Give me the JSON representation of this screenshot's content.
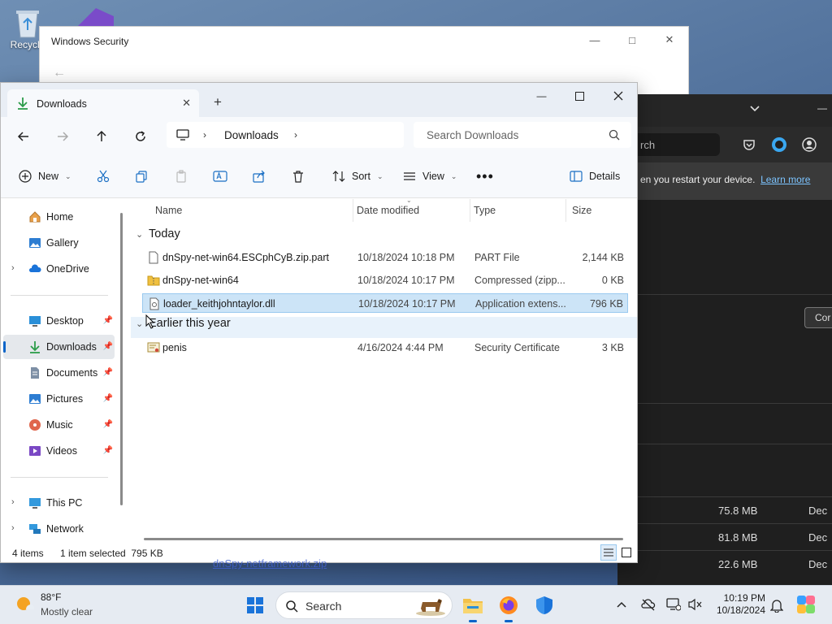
{
  "desktop": {
    "recycle_label": "Recycle"
  },
  "winsec": {
    "title": "Windows Security"
  },
  "browser_bg": {
    "search_placeholder": "rch",
    "notice_text": "en you restart your device.",
    "notice_link": "Learn more",
    "button_label": "Cor",
    "downloads": [
      {
        "size": "75.8 MB",
        "date": "Dec "
      },
      {
        "size": "81.8 MB",
        "date": "Dec "
      },
      {
        "size": "22.6 MB",
        "date": "Dec "
      }
    ],
    "partial_link": "dnSpy-netframework.zip"
  },
  "explorer": {
    "tab_title": "Downloads",
    "breadcrumb": "Downloads",
    "search_placeholder": "Search Downloads",
    "toolbar": {
      "new_label": "New",
      "sort_label": "Sort",
      "view_label": "View",
      "details_label": "Details"
    },
    "nav": {
      "items": [
        {
          "label": "Home",
          "icon": "home-icon"
        },
        {
          "label": "Gallery",
          "icon": "gallery-icon"
        },
        {
          "label": "OneDrive",
          "icon": "cloud-icon"
        },
        {
          "label": "Desktop",
          "icon": "desktop-icon"
        },
        {
          "label": "Downloads",
          "icon": "download-icon"
        },
        {
          "label": "Documents",
          "icon": "documents-icon"
        },
        {
          "label": "Pictures",
          "icon": "pictures-icon"
        },
        {
          "label": "Music",
          "icon": "music-icon"
        },
        {
          "label": "Videos",
          "icon": "videos-icon"
        },
        {
          "label": "This PC",
          "icon": "pc-icon"
        },
        {
          "label": "Network",
          "icon": "network-icon"
        }
      ]
    },
    "columns": {
      "name": "Name",
      "date": "Date modified",
      "type": "Type",
      "size": "Size"
    },
    "groups": [
      {
        "label": "Today",
        "files": [
          {
            "name": "dnSpy-net-win64.ESCphCyB.zip.part",
            "date": "10/18/2024 10:18 PM",
            "type": "PART File",
            "size": "2,144 KB",
            "icon": "file-icon"
          },
          {
            "name": "dnSpy-net-win64",
            "date": "10/18/2024 10:17 PM",
            "type": "Compressed (zipp...",
            "size": "0 KB",
            "icon": "zip-folder-icon"
          },
          {
            "name": "loader_keithjohntaylor.dll",
            "date": "10/18/2024 10:17 PM",
            "type": "Application extens...",
            "size": "796 KB",
            "icon": "dll-file-icon"
          }
        ]
      },
      {
        "label": "Earlier this year",
        "files": [
          {
            "name": "penis",
            "date": "4/16/2024 4:44 PM",
            "type": "Security Certificate",
            "size": "3 KB",
            "icon": "certificate-icon"
          }
        ]
      }
    ],
    "status": {
      "item_count": "4 items",
      "selection": "1 item selected  795 KB"
    }
  },
  "taskbar": {
    "temperature": "88°F",
    "condition": "Mostly clear",
    "search_label": "Search",
    "time": "10:19 PM",
    "date": "10/18/2024"
  }
}
